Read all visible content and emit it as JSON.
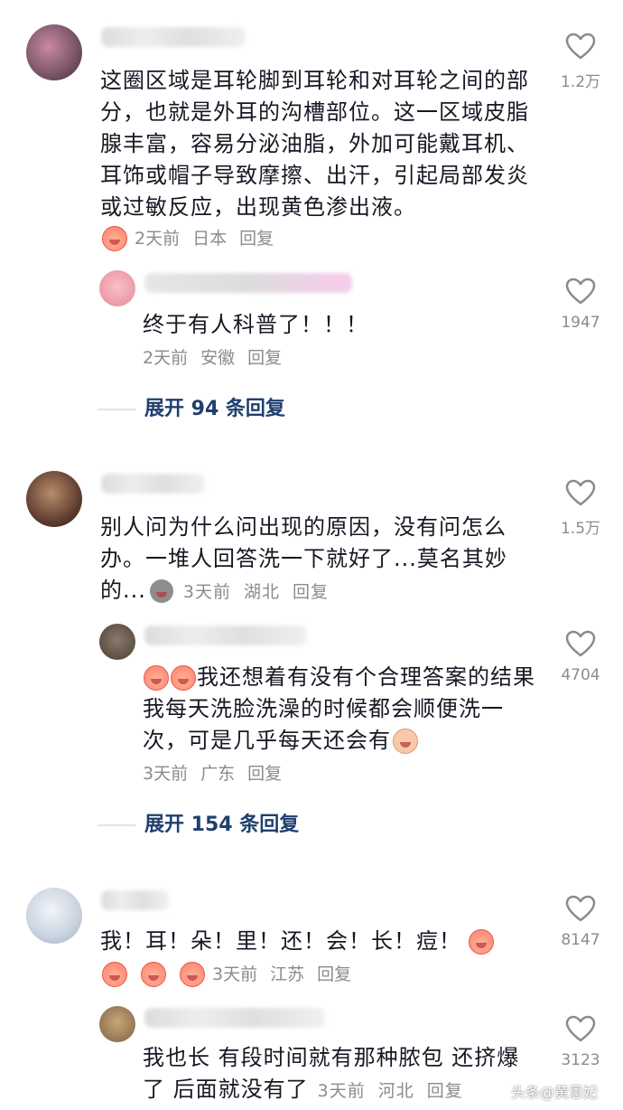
{
  "comments": [
    {
      "text": "这圈区域是耳轮脚到耳轮和对耳轮之间的部分，也就是外耳的沟槽部位。这一区域皮脂腺丰富，容易分泌油脂，外加可能戴耳机、耳饰或帽子导致摩擦、出汗，引起局部发炎或过敏反应，出现黄色渗出液。",
      "time": "2天前",
      "location": "日本",
      "reply": "回复",
      "likes": "1.2万",
      "emoji_icon": "peach-face",
      "replies": [
        {
          "text": "终于有人科普了！！！",
          "time": "2天前",
          "location": "安徽",
          "reply": "回复",
          "likes": "1947"
        }
      ],
      "expand": "展开 94 条回复"
    },
    {
      "text": "别人问为什么问出现的原因，没有问怎么办。一堆人回答洗一下就好了...莫名其妙的...",
      "time": "3天前",
      "location": "湖北",
      "reply": "回复",
      "likes": "1.5万",
      "emoji_icon": "grey-face",
      "replies": [
        {
          "text": "我还想着有没有个合理答案的结果 我每天洗脸洗澡的时候都会顺便洗一次，可是几乎每天还会有",
          "time": "3天前",
          "location": "广东",
          "reply": "回复",
          "likes": "4704"
        }
      ],
      "expand": "展开 154 条回复"
    },
    {
      "text": "我！耳！朵！里！还！会！长！痘！",
      "time": "3天前",
      "location": "江苏",
      "reply": "回复",
      "likes": "8147",
      "emoji_icon": "crying-face",
      "replies": [
        {
          "text": "我也长 有段时间就有那种脓包 还挤爆了 后面就没有了",
          "time": "3天前",
          "location": "河北",
          "reply": "回复",
          "likes": "3123"
        }
      ]
    }
  ],
  "watermark": "头条@黄恩妃",
  "colors": {
    "text": "#161823",
    "meta": "#8a8b91",
    "expand": "#1f3f6e"
  }
}
